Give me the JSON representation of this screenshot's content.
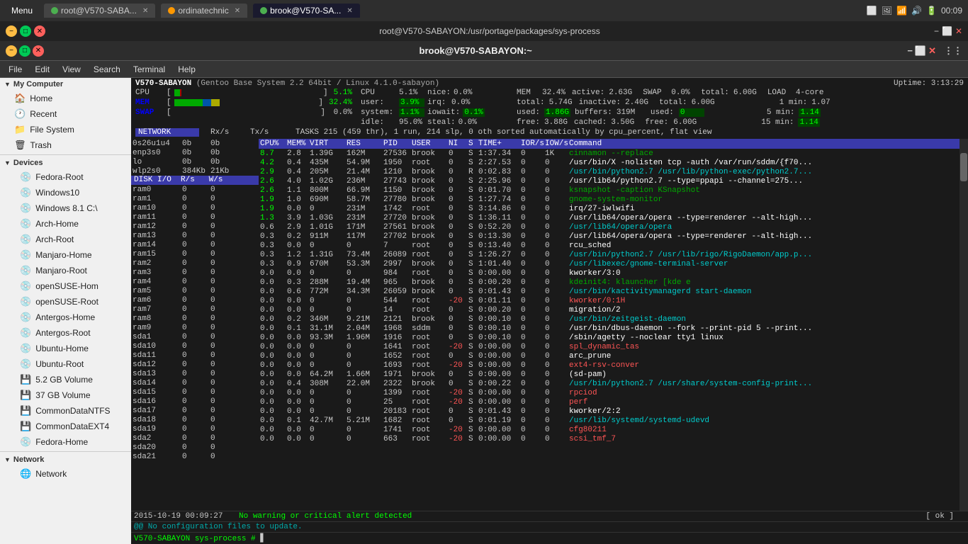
{
  "topbar": {
    "menu_label": "Menu",
    "tabs": [
      {
        "label": "root@V570-SABA...",
        "icon": "green",
        "active": false
      },
      {
        "label": "ordinatechnic",
        "icon": "orange",
        "active": false
      },
      {
        "label": "brook@V570-SA...",
        "icon": "green",
        "active": true
      }
    ],
    "time": "00:09",
    "icons": [
      "screen",
      "image",
      "wifi",
      "volume",
      "battery"
    ]
  },
  "window1": {
    "title": "root@V570-SABAYON:/usr/portage/packages/sys-process"
  },
  "window2": {
    "title": "brook@V570-SABAYON:~"
  },
  "menubar": {
    "items": [
      "File",
      "Edit",
      "View",
      "Search",
      "Terminal",
      "Help"
    ]
  },
  "htop": {
    "uptime": "Uptime: 3:13:29",
    "cpu_bars": [
      {
        "label": "CPU",
        "percent": "5.1%",
        "bar_pct": 5
      },
      {
        "label": "MEM",
        "percent": "32.4%",
        "bar_pct": 32
      },
      {
        "label": "SWAP",
        "percent": "0.0%",
        "bar_pct": 0
      }
    ],
    "cpu_stats": {
      "user": "3.9%",
      "system": "1.1%",
      "nice": "0.0%",
      "irq": "0.0%",
      "iowait": "0.1%",
      "steal": "0.0%",
      "idle": "95.0%"
    },
    "mem_stats": {
      "total": "5.74G",
      "used": "1.86G",
      "buffers": "319M",
      "free": "3.88G",
      "active": "2.63G",
      "inactive": "2.40G",
      "cached": "3.50G"
    },
    "swap_stats": {
      "total": "6.00G",
      "used": "0",
      "free": "6.00G"
    },
    "load": {
      "cores": "4-core",
      "load1": "1.07",
      "load5": "1.14",
      "load15": "1.14"
    },
    "tasks": {
      "total": "215",
      "thr": "459",
      "run": "1",
      "slp": "214",
      "oth": "0",
      "sort": "cpu_percent",
      "view": "flat"
    },
    "processes": [
      {
        "cpu": "8.7",
        "mem": "2.8",
        "virt": "1.39G",
        "res": "162M",
        "pid": "27536",
        "user": "brook",
        "ni": "0",
        "s": "S",
        "time": "1:37.34",
        "ior": "0",
        "iow": "1K",
        "cmd": "cinnamon --replace",
        "cmd_color": "green"
      },
      {
        "cpu": "4.2",
        "mem": "0.4",
        "virt": "435M",
        "res": "54.9M",
        "pid": "1950",
        "user": "root",
        "ni": "0",
        "s": "S",
        "time": "2:27.53",
        "ior": "0",
        "iow": "0",
        "cmd": "/usr/bin/X -nolisten tcp -auth /var/run/sddm/{f70...",
        "cmd_color": "white"
      },
      {
        "cpu": "2.9",
        "mem": "0.4",
        "virt": "205M",
        "res": "21.4M",
        "pid": "1210",
        "user": "brook",
        "ni": "0",
        "s": "R",
        "time": "0:02.83",
        "ior": "0",
        "iow": "0",
        "cmd": "/usr/bin/python2.7 /usr/lib/python-exec/python2.7...",
        "cmd_color": "cyan"
      },
      {
        "cpu": "2.6",
        "mem": "4.0",
        "virt": "1.02G",
        "res": "236M",
        "pid": "27743",
        "user": "brook",
        "ni": "0",
        "s": "S",
        "time": "2:25.96",
        "ior": "0",
        "iow": "0",
        "cmd": "/usr/lib64/python2.7 --type=ppapi --channel=275...",
        "cmd_color": "white"
      },
      {
        "cpu": "2.6",
        "mem": "1.1",
        "virt": "800M",
        "res": "66.9M",
        "pid": "1150",
        "user": "brook",
        "ni": "0",
        "s": "S",
        "time": "0:01.70",
        "ior": "0",
        "iow": "0",
        "cmd": "ksnapshot -caption KSnapshot",
        "cmd_color": "green"
      },
      {
        "cpu": "1.9",
        "mem": "1.0",
        "virt": "690M",
        "res": "58.7M",
        "pid": "27780",
        "user": "brook",
        "ni": "0",
        "s": "S",
        "time": "1:27.74",
        "ior": "0",
        "iow": "0",
        "cmd": "gnome-system-monitor",
        "cmd_color": "green"
      },
      {
        "cpu": "1.9",
        "mem": "0.0",
        "virt": "0",
        "res": "231M",
        "pid": "1742",
        "user": "root",
        "ni": "0",
        "s": "S",
        "time": "3:14.86",
        "ior": "0",
        "iow": "0",
        "cmd": "irq/27-iwlwifi",
        "cmd_color": "white"
      },
      {
        "cpu": "1.3",
        "mem": "3.9",
        "virt": "1.03G",
        "res": "231M",
        "pid": "27720",
        "user": "brook",
        "ni": "0",
        "s": "S",
        "time": "1:36.11",
        "ior": "0",
        "iow": "0",
        "cmd": "/usr/lib64/opera/opera --type=renderer --alt-high...",
        "cmd_color": "white"
      },
      {
        "cpu": "0.6",
        "mem": "2.9",
        "virt": "1.01G",
        "res": "171M",
        "pid": "27561",
        "user": "brook",
        "ni": "0",
        "s": "S",
        "time": "0:52.20",
        "ior": "0",
        "iow": "0",
        "cmd": "/usr/lib64/opera/opera",
        "cmd_color": "cyan"
      },
      {
        "cpu": "0.3",
        "mem": "0.2",
        "virt": "911M",
        "res": "117M",
        "pid": "27702",
        "user": "brook",
        "ni": "0",
        "s": "S",
        "time": "0:13.30",
        "ior": "0",
        "iow": "0",
        "cmd": "/usr/lib64/opera/opera --type=renderer --alt-high...",
        "cmd_color": "white"
      },
      {
        "cpu": "0.3",
        "mem": "0.0",
        "virt": "0",
        "res": "0",
        "pid": "7",
        "user": "root",
        "ni": "0",
        "s": "S",
        "time": "0:13.40",
        "ior": "0",
        "iow": "0",
        "cmd": "rcu_sched",
        "cmd_color": "white"
      },
      {
        "cpu": "0.3",
        "mem": "1.2",
        "virt": "1.31G",
        "res": "73.4M",
        "pid": "26089",
        "user": "root",
        "ni": "0",
        "s": "S",
        "time": "1:26.27",
        "ior": "0",
        "iow": "0",
        "cmd": "/usr/bin/python2.7 /usr/lib/rigo/RigoDaemon/app.p...",
        "cmd_color": "cyan"
      },
      {
        "cpu": "0.3",
        "mem": "0.9",
        "virt": "670M",
        "res": "53.3M",
        "pid": "2997",
        "user": "brook",
        "ni": "0",
        "s": "S",
        "time": "1:01.40",
        "ior": "0",
        "iow": "0",
        "cmd": "/usr/libexec/gnome-terminal-server",
        "cmd_color": "cyan"
      },
      {
        "cpu": "0.0",
        "mem": "0.0",
        "virt": "0",
        "res": "0",
        "pid": "984",
        "user": "root",
        "ni": "0",
        "s": "S",
        "time": "0:00.00",
        "ior": "0",
        "iow": "0",
        "cmd": "kworker/3:0",
        "cmd_color": "white"
      },
      {
        "cpu": "0.0",
        "mem": "0.3",
        "virt": "288M",
        "res": "19.4M",
        "pid": "965",
        "user": "brook",
        "ni": "0",
        "s": "S",
        "time": "0:00.20",
        "ior": "0",
        "iow": "0",
        "cmd": "kdeinit4: klauncher [kde e",
        "cmd_color": "green"
      },
      {
        "cpu": "0.0",
        "mem": "0.6",
        "virt": "772M",
        "res": "34.3M",
        "pid": "26059",
        "user": "brook",
        "ni": "0",
        "s": "S",
        "time": "0:01.43",
        "ior": "0",
        "iow": "0",
        "cmd": "/usr/bin/kactivitymanagerd start-daemon",
        "cmd_color": "cyan"
      },
      {
        "cpu": "0.0",
        "mem": "0.0",
        "virt": "0",
        "res": "0",
        "pid": "544",
        "user": "root",
        "ni": "-20",
        "s": "S",
        "time": "0:01.11",
        "ior": "0",
        "iow": "0",
        "cmd": "kworker/0:1H",
        "cmd_color": "red"
      },
      {
        "cpu": "0.0",
        "mem": "0.0",
        "virt": "0",
        "res": "0",
        "pid": "14",
        "user": "root",
        "ni": "0",
        "s": "S",
        "time": "0:00.20",
        "ior": "0",
        "iow": "0",
        "cmd": "migration/2",
        "cmd_color": "white"
      },
      {
        "cpu": "0.0",
        "mem": "0.2",
        "virt": "346M",
        "res": "9.21M",
        "pid": "2121",
        "user": "brook",
        "ni": "0",
        "s": "S",
        "time": "0:00.10",
        "ior": "0",
        "iow": "0",
        "cmd": "/usr/bin/zeitgeist-daemon",
        "cmd_color": "cyan"
      },
      {
        "cpu": "0.0",
        "mem": "0.1",
        "virt": "31.1M",
        "res": "2.04M",
        "pid": "1968",
        "user": "sddm",
        "ni": "0",
        "s": "S",
        "time": "0:00.10",
        "ior": "0",
        "iow": "0",
        "cmd": "/usr/bin/dbus-daemon --fork --print-pid 5 --print...",
        "cmd_color": "white"
      },
      {
        "cpu": "0.0",
        "mem": "0.0",
        "virt": "93.3M",
        "res": "1.96M",
        "pid": "1916",
        "user": "root",
        "ni": "0",
        "s": "S",
        "time": "0:00.10",
        "ior": "0",
        "iow": "0",
        "cmd": "/sbin/agetty --noclear tty1 linux",
        "cmd_color": "white"
      },
      {
        "cpu": "0.0",
        "mem": "0.0",
        "virt": "0",
        "res": "0",
        "pid": "1641",
        "user": "root",
        "ni": "-20",
        "s": "S",
        "time": "0:00.00",
        "ior": "0",
        "iow": "0",
        "cmd": "spl_dynamic_tas",
        "cmd_color": "red"
      },
      {
        "cpu": "0.0",
        "mem": "0.0",
        "virt": "0",
        "res": "0",
        "pid": "1652",
        "user": "root",
        "ni": "0",
        "s": "S",
        "time": "0:00.00",
        "ior": "0",
        "iow": "0",
        "cmd": "arc_prune",
        "cmd_color": "white"
      },
      {
        "cpu": "0.0",
        "mem": "0.0",
        "virt": "0",
        "res": "0",
        "pid": "1693",
        "user": "root",
        "ni": "-20",
        "s": "S",
        "time": "0:00.00",
        "ior": "0",
        "iow": "0",
        "cmd": "ext4-rsv-conver",
        "cmd_color": "red"
      },
      {
        "cpu": "0.0",
        "mem": "0.0",
        "virt": "64.2M",
        "res": "1.66M",
        "pid": "1971",
        "user": "brook",
        "ni": "0",
        "s": "S",
        "time": "0:00.00",
        "ior": "0",
        "iow": "0",
        "cmd": "(sd-pam)",
        "cmd_color": "white"
      },
      {
        "cpu": "0.0",
        "mem": "0.4",
        "virt": "308M",
        "res": "22.0M",
        "pid": "2322",
        "user": "brook",
        "ni": "0",
        "s": "S",
        "time": "0:00.22",
        "ior": "0",
        "iow": "0",
        "cmd": "/usr/bin/python2.7 /usr/share/system-config-print...",
        "cmd_color": "cyan"
      },
      {
        "cpu": "0.0",
        "mem": "0.0",
        "virt": "0",
        "res": "0",
        "pid": "1399",
        "user": "root",
        "ni": "-20",
        "s": "S",
        "time": "0:00.00",
        "ior": "0",
        "iow": "0",
        "cmd": "rpciod",
        "cmd_color": "red"
      },
      {
        "cpu": "0.0",
        "mem": "0.0",
        "virt": "0",
        "res": "0",
        "pid": "25",
        "user": "root",
        "ni": "-20",
        "s": "S",
        "time": "0:00.00",
        "ior": "0",
        "iow": "0",
        "cmd": "perf",
        "cmd_color": "red"
      },
      {
        "cpu": "0.0",
        "mem": "0.0",
        "virt": "0",
        "res": "0",
        "pid": "20183",
        "user": "root",
        "ni": "0",
        "s": "S",
        "time": "0:01.43",
        "ior": "0",
        "iow": "0",
        "cmd": "kworker/2:2",
        "cmd_color": "white"
      },
      {
        "cpu": "0.0",
        "mem": "0.1",
        "virt": "42.7M",
        "res": "5.21M",
        "pid": "1682",
        "user": "root",
        "ni": "0",
        "s": "S",
        "time": "0:01.19",
        "ior": "0",
        "iow": "0",
        "cmd": "/usr/lib/systemd/systemd-udevd",
        "cmd_color": "cyan"
      },
      {
        "cpu": "0.0",
        "mem": "0.0",
        "virt": "0",
        "res": "0",
        "pid": "1741",
        "user": "root",
        "ni": "-20",
        "s": "S",
        "time": "0:00.00",
        "ior": "0",
        "iow": "0",
        "cmd": "cfg80211",
        "cmd_color": "red"
      },
      {
        "cpu": "0.0",
        "mem": "0.0",
        "virt": "0",
        "res": "0",
        "pid": "663",
        "user": "root",
        "ni": "-20",
        "s": "S",
        "time": "0:00.00",
        "ior": "0",
        "iow": "0",
        "cmd": "scsi_tmf_7",
        "cmd_color": "red"
      }
    ],
    "network_devices": [
      {
        "name": "0s26u1u4",
        "rx": "0b",
        "tx": "0b"
      },
      {
        "name": "enp3s0",
        "rx": "0b",
        "tx": "0b"
      },
      {
        "name": "lo",
        "rx": "0b",
        "tx": "0b"
      },
      {
        "name": "wlp2s0",
        "rx": "384Kb",
        "tx": "21Kb"
      }
    ],
    "disk_devices": [
      {
        "name": "ram0",
        "r": "0",
        "w": "0"
      },
      {
        "name": "ram1",
        "r": "0",
        "w": "0"
      },
      {
        "name": "ram10",
        "r": "0",
        "w": "0"
      },
      {
        "name": "ram11",
        "r": "0",
        "w": "0"
      },
      {
        "name": "ram12",
        "r": "0",
        "w": "0"
      },
      {
        "name": "ram13",
        "r": "0",
        "w": "0"
      },
      {
        "name": "ram14",
        "r": "0",
        "w": "0"
      },
      {
        "name": "ram15",
        "r": "0",
        "w": "0"
      },
      {
        "name": "ram2",
        "r": "0",
        "w": "0"
      },
      {
        "name": "ram3",
        "r": "0",
        "w": "0"
      },
      {
        "name": "ram4",
        "r": "0",
        "w": "0"
      },
      {
        "name": "ram5",
        "r": "0",
        "w": "0"
      },
      {
        "name": "ram6",
        "r": "0",
        "w": "0"
      },
      {
        "name": "ram7",
        "r": "0",
        "w": "0"
      },
      {
        "name": "ram8",
        "r": "0",
        "w": "0"
      },
      {
        "name": "ram9",
        "r": "0",
        "w": "0"
      },
      {
        "name": "sda1",
        "r": "0",
        "w": "0"
      },
      {
        "name": "sda10",
        "r": "0",
        "w": "0"
      },
      {
        "name": "sda11",
        "r": "0",
        "w": "0"
      },
      {
        "name": "sda12",
        "r": "0",
        "w": "0"
      },
      {
        "name": "sda13",
        "r": "0",
        "w": "0"
      },
      {
        "name": "sda14",
        "r": "0",
        "w": "0"
      },
      {
        "name": "sda15",
        "r": "0",
        "w": "0"
      },
      {
        "name": "sda16",
        "r": "0",
        "w": "0"
      },
      {
        "name": "sda17",
        "r": "0",
        "w": "0"
      },
      {
        "name": "sda18",
        "r": "0",
        "w": "0"
      },
      {
        "name": "sda19",
        "r": "0",
        "w": "0"
      },
      {
        "name": "sda2",
        "r": "0",
        "w": "0"
      },
      {
        "name": "sda20",
        "r": "0",
        "w": "0"
      },
      {
        "name": "sda21",
        "r": "0",
        "w": "0"
      }
    ],
    "status": {
      "datetime": "2015-10-19 00:09:27",
      "notice": "No warning or critical alert detected",
      "config_notice": "@@ No configuration files to update.",
      "prompt": "V570-SABAYON sys-process #"
    }
  },
  "sidebar": {
    "my_computer": "My Computer",
    "items_mycomputer": [
      "Home",
      "Recent",
      "File System",
      "Trash"
    ],
    "devices_label": "Devices",
    "devices": [
      "Fedora-Root",
      "Windows10",
      "Windows 8.1 C:\\",
      "Arch-Home",
      "Arch-Root",
      "Manjaro-Home",
      "Manjaro-Root",
      "openSUSE-Hom",
      "openSUSE-Root",
      "Antergos-Home",
      "Antergos-Root",
      "Ubuntu-Home",
      "Ubuntu-Root",
      "5.2 GB Volume",
      "37 GB Volume",
      "CommonDataNTFS",
      "CommonDataEXT4",
      "Fedora-Home"
    ],
    "network_label": "Network",
    "network_items": [
      "Network"
    ]
  },
  "colors": {
    "accent": "#3a3aaa",
    "terminal_bg": "#1a1a1a",
    "sidebar_bg": "#f0f0f0",
    "green": "#00ff00",
    "red": "#ff5555",
    "cyan": "#00aaaa",
    "blue": "#5555ff"
  }
}
